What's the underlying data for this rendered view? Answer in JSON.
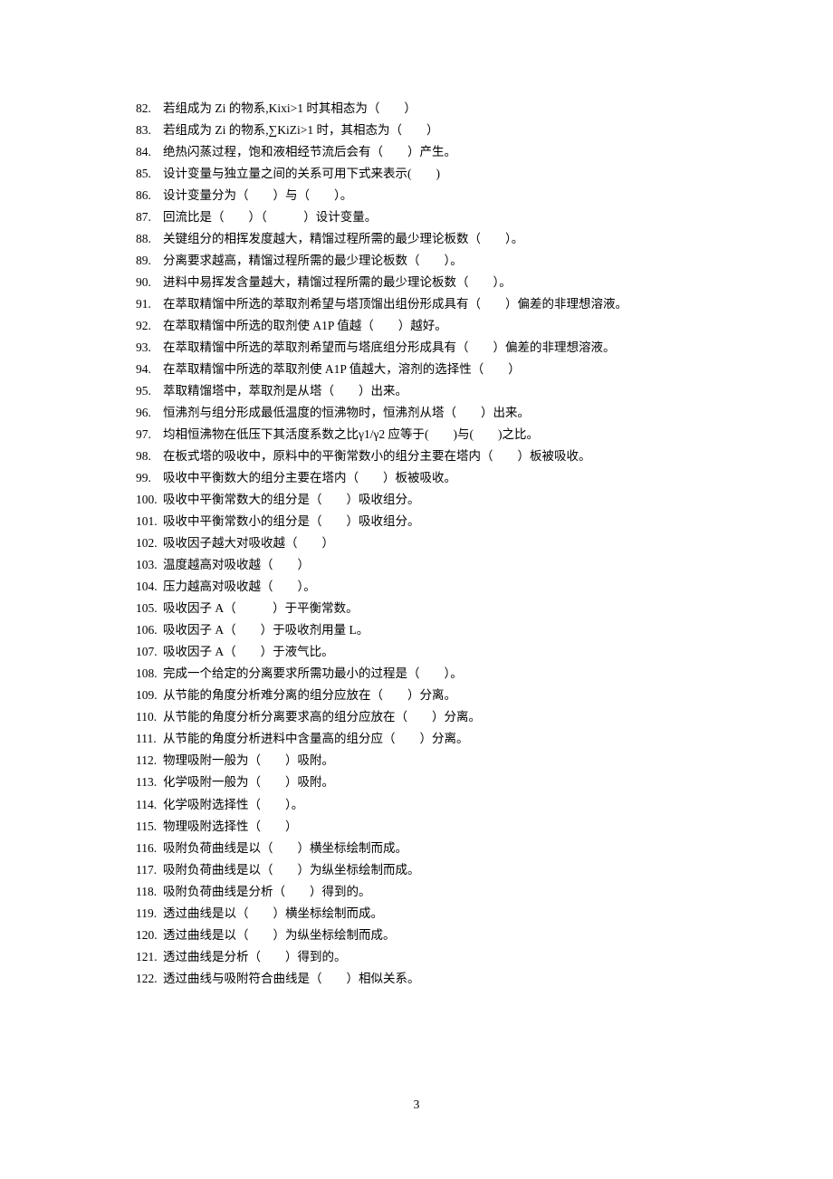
{
  "page_number": "3",
  "items": [
    {
      "n": "82.",
      "t": "若组成为 Zi 的物系,Kixi>1 时其相态为（　　）"
    },
    {
      "n": "83.",
      "t": "若组成为 Zi 的物系,∑KiZi>1 时，其相态为（　　）"
    },
    {
      "n": "84.",
      "t": "绝热闪蒸过程，饱和液相经节流后会有（　　）产生。"
    },
    {
      "n": "85.",
      "t": "设计变量与独立量之间的关系可用下式来表示(　　)"
    },
    {
      "n": "86.",
      "t": "设计变量分为（　　）与（　　）。"
    },
    {
      "n": "87.",
      "t": "回流比是（　　）（　　　）设计变量。"
    },
    {
      "n": "88.",
      "t": "关键组分的相挥发度越大，精馏过程所需的最少理论板数（　　）。"
    },
    {
      "n": "89.",
      "t": "分离要求越高，精馏过程所需的最少理论板数（　　）。"
    },
    {
      "n": "90.",
      "t": "进料中易挥发含量越大，精馏过程所需的最少理论板数（　　）。"
    },
    {
      "n": "91.",
      "t": "在萃取精馏中所选的萃取剂希望与塔顶馏出组份形成具有（　　）偏差的非理想溶液。"
    },
    {
      "n": "92.",
      "t": "在萃取精馏中所选的取剂使 A1P 值越（　　）越好。"
    },
    {
      "n": "93.",
      "t": "在萃取精馏中所选的萃取剂希望而与塔底组分形成具有（　　）偏差的非理想溶液。"
    },
    {
      "n": "94.",
      "t": "在萃取精馏中所选的萃取剂使 A1P 值越大，溶剂的选择性（　　）"
    },
    {
      "n": "95.",
      "t": "萃取精馏塔中，萃取剂是从塔（　　）出来。"
    },
    {
      "n": "96.",
      "t": "恒沸剂与组分形成最低温度的恒沸物时，恒沸剂从塔（　　）出来。"
    },
    {
      "n": "97.",
      "t": "均相恒沸物在低压下其活度系数之比γ1/γ2 应等于(　　)与(　　)之比。"
    },
    {
      "n": "98.",
      "t": "在板式塔的吸收中，原料中的平衡常数小的组分主要在塔内（　　）板被吸收。"
    },
    {
      "n": "99.",
      "t": "吸收中平衡数大的组分主要在塔内（　　）板被吸收。"
    },
    {
      "n": "100.",
      "t": "吸收中平衡常数大的组分是（　　）吸收组分。"
    },
    {
      "n": "101.",
      "t": "吸收中平衡常数小的组分是（　　）吸收组分。"
    },
    {
      "n": "102.",
      "t": "吸收因子越大对吸收越（　　）"
    },
    {
      "n": "103.",
      "t": "温度越高对吸收越（　　）"
    },
    {
      "n": "104.",
      "t": "压力越高对吸收越（　　）。"
    },
    {
      "n": "105.",
      "t": "吸收因子 A（　　　）于平衡常数。"
    },
    {
      "n": "106.",
      "t": "吸收因子 A（　　）于吸收剂用量 L。"
    },
    {
      "n": "107.",
      "t": "吸收因子 A（　　）于液气比。"
    },
    {
      "n": "108.",
      "t": "完成一个给定的分离要求所需功最小的过程是（　　）。"
    },
    {
      "n": "109.",
      "t": "从节能的角度分析难分离的组分应放在（　　）分离。"
    },
    {
      "n": "110.",
      "t": "从节能的角度分析分离要求高的组分应放在（　　）分离。"
    },
    {
      "n": "111.",
      "t": "从节能的角度分析进料中含量高的组分应（　　）分离。"
    },
    {
      "n": "112.",
      "t": "物理吸附一般为（　　）吸附。"
    },
    {
      "n": "113.",
      "t": "化学吸附一般为（　　）吸附。"
    },
    {
      "n": "114.",
      "t": "化学吸附选择性（　　）。"
    },
    {
      "n": "115.",
      "t": "物理吸附选择性（　　）"
    },
    {
      "n": "116.",
      "t": "吸附负荷曲线是以（　　）横坐标绘制而成。"
    },
    {
      "n": "117.",
      "t": "吸附负荷曲线是以（　　）为纵坐标绘制而成。"
    },
    {
      "n": "118.",
      "t": "吸附负荷曲线是分析（　　）得到的。"
    },
    {
      "n": "119.",
      "t": "透过曲线是以（　　）横坐标绘制而成。"
    },
    {
      "n": "120.",
      "t": "透过曲线是以（　　）为纵坐标绘制而成。"
    },
    {
      "n": "121.",
      "t": "透过曲线是分析（　　）得到的。"
    },
    {
      "n": "122.",
      "t": "透过曲线与吸附符合曲线是（　　）相似关系。"
    }
  ]
}
